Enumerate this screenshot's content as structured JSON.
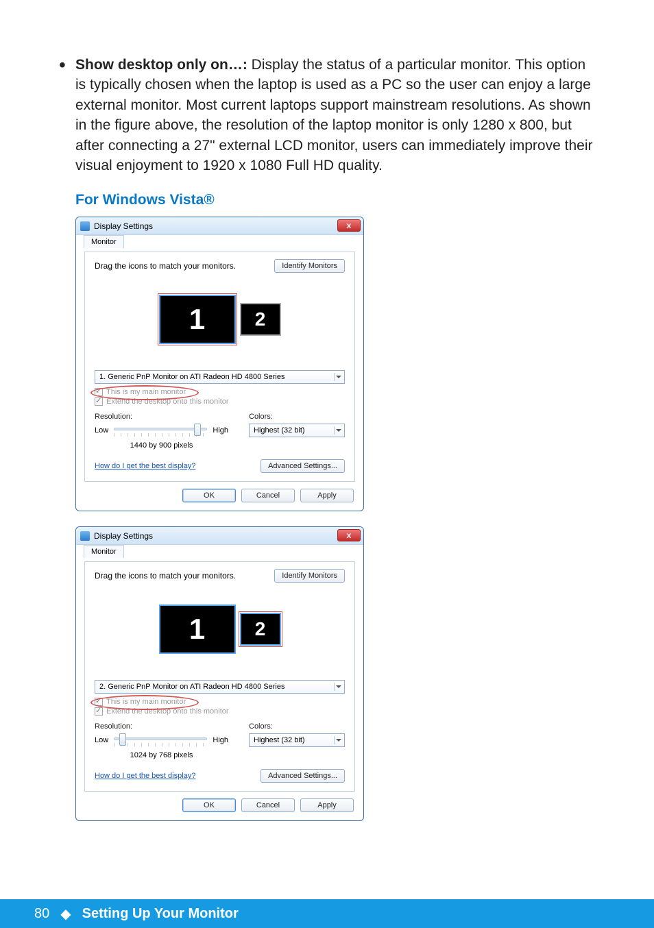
{
  "body": {
    "bullet_strong": "Show desktop only on…:",
    "bullet_rest": " Display the status of a particular monitor. This option is typically chosen when the laptop is used as a PC so the user can enjoy a large external monitor. Most current laptops support mainstream resolutions. As shown in the figure above, the resolution of the laptop monitor is only 1280 x 800, but after connecting a 27\" external LCD monitor, users can immediately improve their visual enjoyment to 1920 x 1080 Full HD quality.",
    "subheading": "For Windows Vista®"
  },
  "dialog": {
    "title": "Display Settings",
    "close_glyph": "x",
    "tab": "Monitor",
    "drag_text": "Drag the icons to match your monitors.",
    "identify_btn": "Identify Monitors",
    "monitor1_num": "1",
    "monitor2_num": "2",
    "chk_main": "This is my main monitor",
    "chk_extend": "Extend the desktop onto this monitor",
    "res_label": "Resolution:",
    "res_low": "Low",
    "res_high": "High",
    "colors_label": "Colors:",
    "colors_value": "Highest (32 bit)",
    "help_link": "How do I get the best display?",
    "adv_btn": "Advanced Settings...",
    "ok": "OK",
    "cancel": "Cancel",
    "apply": "Apply"
  },
  "dlg1": {
    "dd_value": "1. Generic PnP Monitor on ATI Radeon HD 4800 Series",
    "res_text": "1440 by 900 pixels",
    "thumb_pct": 86
  },
  "dlg2": {
    "dd_value": "2. Generic PnP Monitor on ATI Radeon HD 4800 Series",
    "res_text": "1024 by 768 pixels",
    "thumb_pct": 6
  },
  "footer": {
    "page": "80",
    "diamond": "◆",
    "section": "Setting Up Your Monitor"
  }
}
